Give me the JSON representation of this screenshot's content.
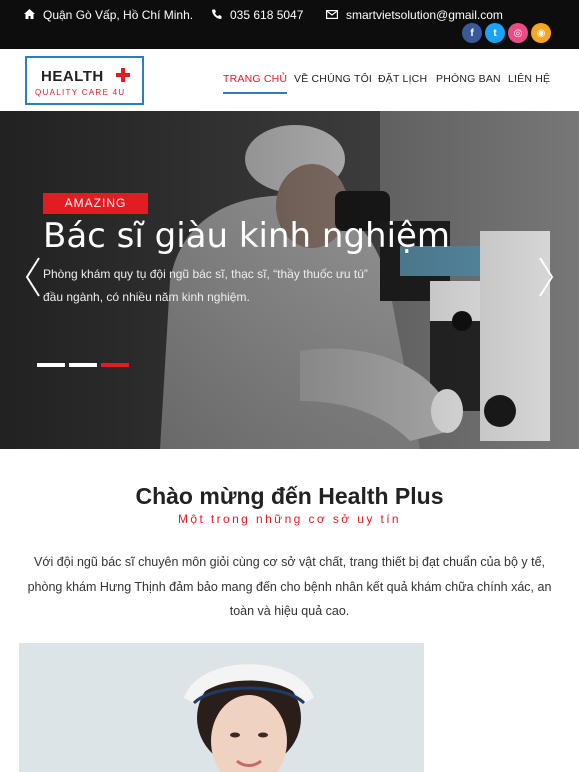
{
  "topbar": {
    "address": "Quận Gò Vấp, Hồ Chí Minh.",
    "phone": "035 618 5047",
    "email": "smartvietsolution@gmail.com",
    "icons": {
      "address": "home-icon",
      "phone": "phone-icon",
      "email": "envelope-icon"
    },
    "socials": [
      {
        "name": "facebook-icon",
        "glyph": "f",
        "color": "#3b5998"
      },
      {
        "name": "twitter-icon",
        "glyph": "t",
        "color": "#1da1f2"
      },
      {
        "name": "dribbble-icon",
        "glyph": "◎",
        "color": "#ea4c89"
      },
      {
        "name": "rss-icon",
        "glyph": "◉",
        "color": "#f5a623"
      }
    ]
  },
  "logo": {
    "line1": "HEALTH",
    "line2": "QUALITY CARE 4U"
  },
  "nav": {
    "items": [
      "TRANG CHỦ",
      "VỀ CHÚNG TÔI",
      "ĐẶT LỊCH",
      "PHÒNG BAN",
      "LIÊN HỆ"
    ],
    "active_index": 0
  },
  "hero": {
    "badge": "AMAZING",
    "title": "Bác sĩ giàu kinh nghiệm",
    "description": "Phòng khám quy tụ đội ngũ bác sĩ, thạc sĩ, “thầy thuốc ưu tú” đầu ngành, có nhiều năm kinh nghiệm.",
    "slide_count": 3,
    "active_slide": 2
  },
  "welcome": {
    "title": "Chào mừng đến Health Plus",
    "subtitle": "Một trong những cơ sở uy tín",
    "text": "Với đội ngũ bác sĩ chuyên môn giỏi cùng cơ sở vật chất, trang thiết bị đạt chuẩn của bộ y tế, phòng khám Hưng Thịnh đảm bảo mang đến cho bệnh nhân kết quả khám chữa chính xác, an toàn và hiệu quả cao."
  },
  "colors": {
    "accent": "#e31b23",
    "brand_blue": "#2a7fc1",
    "topbar": "#0d0d0d"
  }
}
